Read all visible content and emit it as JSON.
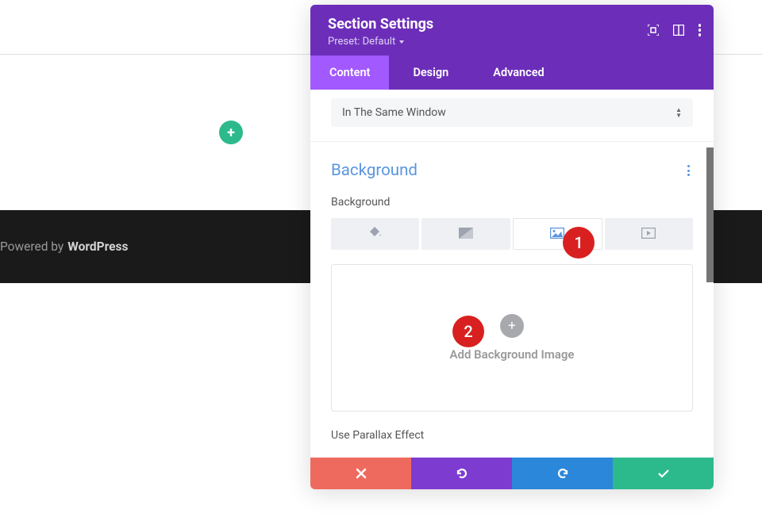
{
  "page": {
    "footer_prefix": "Powered by ",
    "footer_brand": "WordPress"
  },
  "modal": {
    "title": "Section Settings",
    "preset": "Preset: Default",
    "tabs": {
      "content": "Content",
      "design": "Design",
      "advanced": "Advanced"
    },
    "select_value": "In The Same Window",
    "background": {
      "section_title": "Background",
      "label": "Background",
      "add_image_text": "Add Background Image",
      "parallax_label": "Use Parallax Effect"
    },
    "annotations": {
      "one": "1",
      "two": "2"
    },
    "colors": {
      "header": "#6c2eb9",
      "tab_active": "#a259ff",
      "green": "#2cba8d",
      "red": "#ef6a5e",
      "blue": "#2b87da",
      "annotation": "#d92020"
    }
  }
}
